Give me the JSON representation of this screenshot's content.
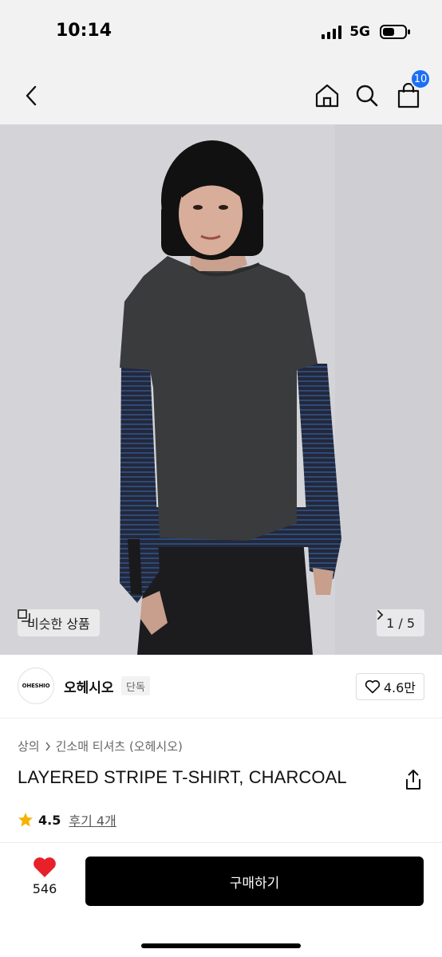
{
  "status_bar": {
    "time": "10:14",
    "network": "5G",
    "icons": [
      "signal-bars-icon",
      "battery-icon"
    ]
  },
  "nav": {
    "icons": [
      "back-chevron-icon",
      "home-icon",
      "search-icon",
      "shopping-bag-icon"
    ],
    "cart_count": "10"
  },
  "hero": {
    "similar_label": "비슷한 상품",
    "page_indicator": "1 / 5",
    "similar_icon": "copy-icon",
    "next_icon": "chevron-right-icon"
  },
  "brand": {
    "logo_text": "OHESHIO",
    "name": "오헤시오",
    "badge": "단독",
    "likes": "4.6만",
    "like_icon": "heart-outline-icon"
  },
  "product": {
    "breadcrumb": [
      "상의",
      "긴소매 티셔츠 (오헤시오)"
    ],
    "title": "LAYERED STRIPE T-SHIRT, CHARCOAL",
    "rating": "4.5",
    "reviews": "후기 4개",
    "share_icon": "share-icon",
    "star_icon": "star-icon"
  },
  "bottom": {
    "wish_count": "546",
    "wish_icon": "heart-filled-icon",
    "buy_label": "구매하기"
  },
  "colors": {
    "accent": "#1b6ff5",
    "heart": "#e8202a",
    "star": "#f5b301",
    "buy_button": "#000000"
  }
}
